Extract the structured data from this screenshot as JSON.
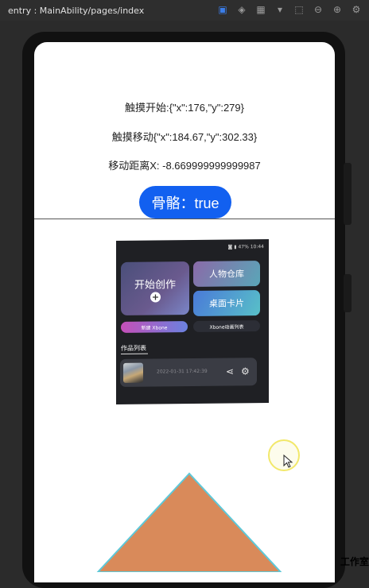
{
  "ide": {
    "path": "entry : MainAbility/pages/index",
    "toolbar_icons": [
      "device-icon",
      "layers-icon",
      "grid-icon",
      "chevron-down-icon",
      "fit-icon",
      "zoom-out-icon",
      "zoom-in-icon",
      "settings-icon"
    ]
  },
  "app": {
    "touch_start": "触摸开始:{\"x\":176,\"y\":279}",
    "touch_move": "触摸移动{\"x\":184.67,\"y\":302.33}",
    "move_distance": "移动距离X: -8.669999999999987",
    "bone_button": "骨骼：true"
  },
  "embedded": {
    "status_right": "◙ ▮ 47% 10:44",
    "start_create": "开始创作",
    "plus": "+",
    "character_warehouse": "人物仓库",
    "desktop_card": "桌面卡片",
    "new_xbone": "新建 Xbone",
    "xbone_anim_list": "Xbone动画列表",
    "works_list": "作品列表",
    "work_date": "2022-01-31 17:42:39"
  },
  "watermark": "工作室",
  "colors": {
    "accent": "#1260f0",
    "triangle_fill": "#d98a5a",
    "triangle_stroke": "#5ec8d8"
  }
}
